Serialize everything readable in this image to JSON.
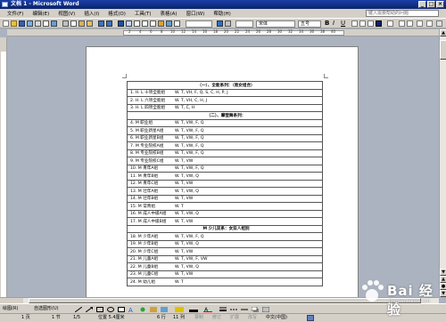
{
  "window": {
    "title": "文档 1 - Microsoft Word",
    "minimize": "_",
    "maximize": "□",
    "close": "×"
  },
  "menu": {
    "items": [
      "文件(F)",
      "编辑(E)",
      "视图(V)",
      "插入(I)",
      "格式(O)",
      "工具(T)",
      "表格(A)",
      "窗口(W)",
      "帮助(H)"
    ],
    "help_box": "键入需要帮助的问题"
  },
  "toolbar": {
    "font": "宋体",
    "size": "五号",
    "bold": "B",
    "italic": "I",
    "underline": "U"
  },
  "ruler": {
    "ticks": [
      "2",
      "4",
      "6",
      "8",
      "10",
      "12",
      "14",
      "16",
      "18",
      "20",
      "22",
      "24",
      "26",
      "28",
      "30",
      "32",
      "34",
      "36",
      "38",
      "40"
    ]
  },
  "document": {
    "rows": [
      {
        "type": "head",
        "text": "（一）、全能系列：（易女组合）"
      },
      {
        "type": "row",
        "code": "1. H. L 十项全能组",
        "groups": "W. T, VH, F, Q, S, C, H, P, J"
      },
      {
        "type": "row",
        "code": "2. H. L 六项全能组",
        "groups": "W. T, VH, C, H, J"
      },
      {
        "type": "row",
        "code": "3. H. L 四项全能组",
        "groups": "W. T, C, H"
      },
      {
        "type": "head",
        "text": "（二）、摩登舞系列："
      },
      {
        "type": "row",
        "code": "4. M 职业组",
        "groups": "W. T, VW, F, Q"
      },
      {
        "type": "row",
        "code": "5. M 职业新星A组",
        "groups": "W. T, VW, F, Q"
      },
      {
        "type": "row",
        "code": "6. M 职业新星B组",
        "groups": "W. T, VW, F, Q"
      },
      {
        "type": "row",
        "code": "7. M 专业院校A组",
        "groups": "W. T, VW, F, Q"
      },
      {
        "type": "row",
        "code": "8. M 专业院校B组",
        "groups": "W. T, VW, F, Q"
      },
      {
        "type": "row",
        "code": "9. M 专业院校C组",
        "groups": "W. T, VW"
      },
      {
        "type": "row",
        "code": "10. M 青年A组",
        "groups": "W. T, VW, F, Q"
      },
      {
        "type": "row",
        "code": "11. M 青年B组",
        "groups": "W. T, VW, Q"
      },
      {
        "type": "row",
        "code": "12. M 青年C组",
        "groups": "W. T, VW"
      },
      {
        "type": "row",
        "code": "13. M 壮年A组",
        "groups": "W. T, VW, Q"
      },
      {
        "type": "row",
        "code": "14. M 壮年B组",
        "groups": "W. T, VW"
      },
      {
        "type": "row",
        "code": "15. M 常青组",
        "groups": "W. T"
      },
      {
        "type": "row",
        "code": "16. M 成人中级A组",
        "groups": "W. T, VW, Q"
      },
      {
        "type": "row",
        "code": "17. M 成人中级B组",
        "groups": "W. T, VW"
      },
      {
        "type": "head",
        "text": "M 少儿双系：女双人组别"
      },
      {
        "type": "row",
        "code": "18. M 少年A组",
        "groups": "W. T, VW, F, Q"
      },
      {
        "type": "row",
        "code": "19. M 少年B组",
        "groups": "W. T, VW, Q"
      },
      {
        "type": "row",
        "code": "20. M 少年C组",
        "groups": "W. T, VW"
      },
      {
        "type": "row",
        "code": "21. M 儿童A组",
        "groups": "W. T, VW, F, VW"
      },
      {
        "type": "row",
        "code": "22. M 儿童B组",
        "groups": "W. T, VW, Q"
      },
      {
        "type": "row",
        "code": "23. M 儿童C组",
        "groups": "W. T, VW"
      },
      {
        "type": "row",
        "code": "24. M 幼儿组",
        "groups": "W. T"
      }
    ]
  },
  "drawbar": {
    "draw": "绘图(R)",
    "autoshape": "自选图形(U)"
  },
  "status": {
    "page": "1 页",
    "section": "1 节",
    "pages": "1/5",
    "position": "位置 5.4厘米",
    "line": "6 行",
    "column": "11 列",
    "rec": "录制",
    "trk": "修订",
    "ext": "扩展",
    "ovr": "改写",
    "lang": "中文(中国)"
  },
  "watermark": {
    "text": "Bai 经验",
    "sub": "jingyan.baidu.com"
  }
}
